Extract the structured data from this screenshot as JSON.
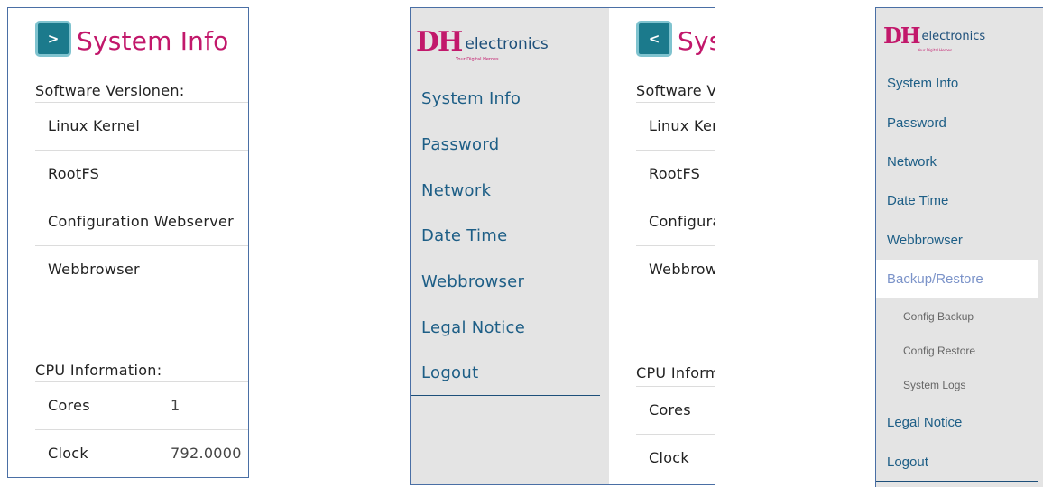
{
  "panel1": {
    "toggle_glyph": ">",
    "title": "System Info",
    "software_heading": "Software Versionen:",
    "software_rows": [
      "Linux Kernel",
      "RootFS",
      "Configuration Webserver",
      "Webbrowser"
    ],
    "cpu_heading": "CPU Information:",
    "cpu_rows": [
      {
        "label": "Cores",
        "value": "1"
      },
      {
        "label": "Clock",
        "value": "792.0000"
      }
    ]
  },
  "panel2": {
    "logo_mark": "DH",
    "logo_text": "electronics",
    "logo_tagline": "Your Digital Heroes.",
    "nav": [
      "System Info",
      "Password",
      "Network",
      "Date Time",
      "Webbrowser",
      "Legal Notice",
      "Logout"
    ],
    "toggle_glyph": "<",
    "title": "System Info",
    "software_heading": "Software Versionen:",
    "software_rows": [
      "Linux Kernel",
      "RootFS",
      "Configuration Webserver",
      "Webbrowser"
    ],
    "cpu_heading": "CPU Information:",
    "cpu_rows": [
      "Cores",
      "Clock"
    ]
  },
  "panel3": {
    "logo_mark": "DH",
    "logo_text": "electronics",
    "logo_tagline": "Your Digital Heroes.",
    "nav": [
      "System Info",
      "Password",
      "Network",
      "Date Time",
      "Webbrowser"
    ],
    "active": "Backup/Restore",
    "sub": [
      "Config Backup",
      "Config Restore",
      "System Logs"
    ],
    "nav_after": [
      "Legal Notice",
      "Logout"
    ]
  },
  "colors": {
    "accent": "#c2186b",
    "link": "#1d5e86",
    "toggle": "#1b7a8c",
    "sidebar_bg": "#e4e4e4",
    "active_link": "#7b93c9"
  }
}
